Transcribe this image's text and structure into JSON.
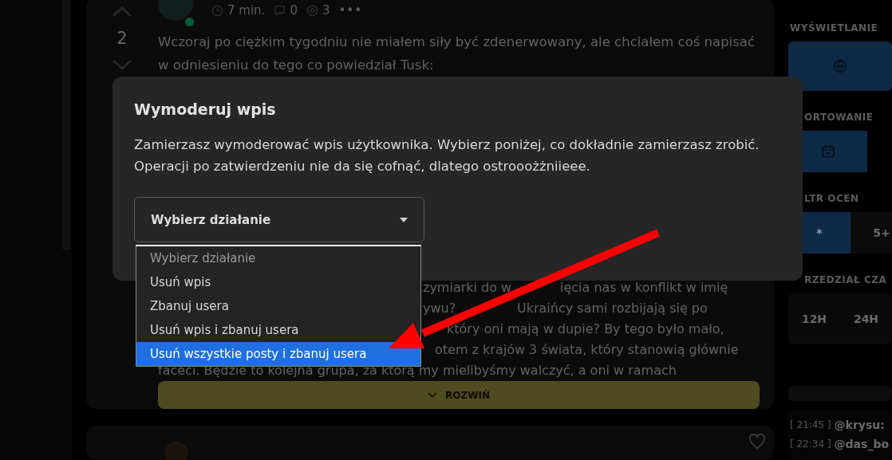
{
  "post": {
    "votes": "2",
    "meta": {
      "time": "7 min.",
      "comments": "0",
      "views": "3",
      "more": "•••"
    },
    "lines_top": [
      "Wczoraj po ciężkim tygodniu nie miałem siły być zdenerwowany, ale chciałem coś napisać",
      "w odniesieniu do tego co powiedział Tusk:"
    ],
    "lines_bottom": [
      [
        "zymiarki do w",
        "ięcia nas w konflikt w imię"
      ],
      [
        "ywu?",
        "Ukraińcy sami rozbijają się po"
      ],
      [
        "który oni mają w dupie? By tego było mało,"
      ],
      [
        "otem z krajów 3 świata, który stanowią głównie"
      ],
      [
        "faceci. Będzie to kolejna grupa, za którą my mielibyśmy walczyć, a oni w ramach"
      ]
    ],
    "expand": "ROZWIŃ"
  },
  "sidebar": {
    "sections": [
      {
        "title": "WYŚWIETLANIE",
        "options": [
          {
            "kind": "globe",
            "selected": true
          }
        ]
      },
      {
        "title": "ORTOWANIE",
        "options": [
          {
            "kind": "calendar",
            "selected": true
          }
        ]
      },
      {
        "title": "LTR OCEN",
        "options": [
          {
            "kind": "text",
            "label": "*",
            "selected": true
          },
          {
            "kind": "text",
            "label": "5+",
            "selected": false
          }
        ]
      },
      {
        "title": "RZEDZIAŁ CZA",
        "options": [
          {
            "kind": "text",
            "label": "12H",
            "selected": false
          },
          {
            "kind": "text",
            "label": "24H",
            "selected": false
          }
        ]
      }
    ],
    "chat": [
      {
        "time": "[ 21:45 ]",
        "user": "@krysu:"
      },
      {
        "time": "[ 22:34 ]",
        "user": "@das_bo"
      }
    ]
  },
  "modal": {
    "title": "Wymoderuj wpis",
    "message": "Zamierzasz wymoderować wpis użytkownika. Wybierz poniżej, co dokładnie zamierzasz zrobić. Operacji po zatwierdzeniu nie da się cofnąć, dlatego ostrooożżniieee.",
    "select": {
      "value": "Wybierz działanie"
    },
    "options": [
      {
        "label": "Wybierz działanie",
        "disabled": true,
        "selected": false
      },
      {
        "label": "Usuń wpis",
        "disabled": false,
        "selected": false
      },
      {
        "label": "Zbanuj usera",
        "disabled": false,
        "selected": false
      },
      {
        "label": "Usuń wpis i zbanuj usera",
        "disabled": false,
        "selected": false
      },
      {
        "label": "Usuń wszystkie posty i zbanuj usera",
        "disabled": false,
        "selected": true
      }
    ]
  }
}
